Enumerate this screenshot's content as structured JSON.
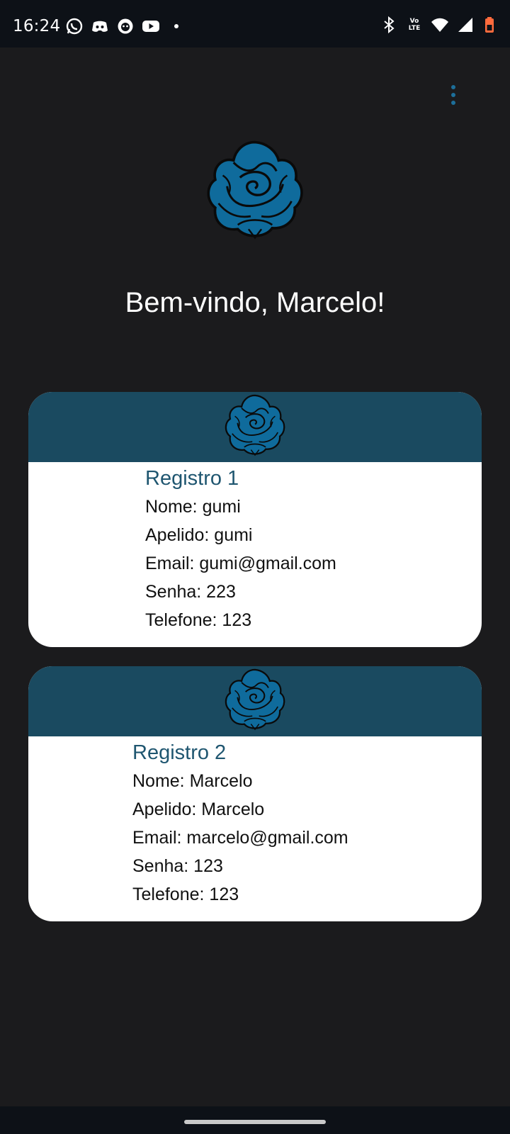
{
  "status_bar": {
    "time": "16:24",
    "left_icons": [
      "whatsapp-icon",
      "discord-icon",
      "app-icon",
      "youtube-icon",
      "dot-icon"
    ],
    "right_icons": [
      "bluetooth-icon",
      "volte-icon",
      "wifi-icon",
      "signal-icon",
      "battery-icon"
    ],
    "volte_top": "Vo",
    "volte_bottom": "LTE"
  },
  "colors": {
    "background": "#1b1b1d",
    "card_header": "#1a4a60",
    "accent": "#1d6f9a",
    "title_text": "#1f5670"
  },
  "header": {
    "logo": "rose-logo",
    "welcome": "Bem-vindo, Marcelo!"
  },
  "records": [
    {
      "title": "Registro 1",
      "nome": "Nome: gumi",
      "apelido": "Apelido: gumi",
      "email": "Email: gumi@gmail.com",
      "senha": "Senha: 223",
      "telefone": "Telefone: 123"
    },
    {
      "title": "Registro 2",
      "nome": "Nome: Marcelo",
      "apelido": "Apelido: Marcelo",
      "email": "Email: marcelo@gmail.com",
      "senha": "Senha: 123",
      "telefone": "Telefone: 123"
    }
  ]
}
